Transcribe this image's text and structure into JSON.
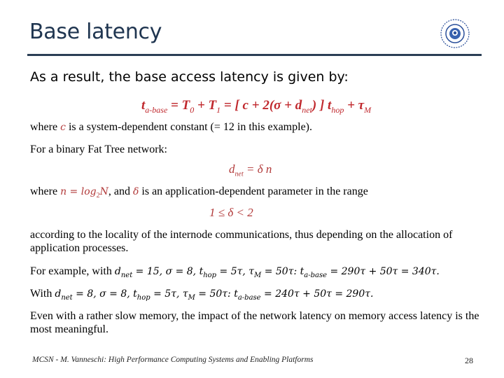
{
  "slide": {
    "title": "Base latency",
    "logo": "university-seal-icon",
    "intro": "As a result, the base access latency is given by:",
    "main_equation": {
      "lhs_var": "t",
      "lhs_sub": "a-base",
      "rhs": "= T",
      "t0_sub": "0",
      "plus1": " + T",
      "t1_sub": "1",
      "bracket": " = [ c + 2(σ + d",
      "dnet_sub": "net",
      "close": ") ]  t",
      "thop_sub": "hop",
      "plus_tau": " + τ",
      "tau_sub": "M"
    },
    "line_c": {
      "pre": "where ",
      "var": "c",
      "post": " is a system-dependent constant (= 12 in this example)."
    },
    "fat_tree_intro": "For a binary Fat Tree network:",
    "dnet_eq": {
      "d": "d",
      "sub": "net",
      "rest": " = δ n"
    },
    "line_n": {
      "pre": "where ",
      "n_eq": "n = log",
      "n_sub": "2",
      "n_post": "N",
      "mid": ", and ",
      "delta": "δ",
      "post": " is an application-dependent parameter in the range"
    },
    "range_eq": "1 ≤ δ < 2",
    "locality": "according to the locality of the internode communications, thus depending on the allocation of application processes.",
    "example1": {
      "pre": "For example, with ",
      "d": "d",
      "d_sub": "net",
      "d_val": " = 15, σ = 8, t",
      "hop_sub": "hop",
      "hop_val": " = 5τ, τ",
      "m_sub": "M",
      "m_val": " = 50τ:  t",
      "base_sub": "a-base",
      "result": " = 290τ + 50τ = 340τ."
    },
    "example2": {
      "pre": "With ",
      "d": "d",
      "d_sub": "net",
      "d_val": " = 8, σ = 8, t",
      "hop_sub": "hop",
      "hop_val": " = 5τ, τ",
      "m_sub": "M",
      "m_val": " = 50τ:  t",
      "base_sub": "a-base",
      "result": " = 240τ + 50τ = 290τ."
    },
    "conclusion": "Even with a rather slow memory, the impact of the network latency on memory access latency is the most meaningful.",
    "footer": "MCSN  -    M. Vanneschi: High Performance Computing Systems and Enabling Platforms",
    "page_number": "28",
    "colors": {
      "title": "#1f3550",
      "accent_red": "#c0282d",
      "rule": "#2b3f55"
    }
  }
}
